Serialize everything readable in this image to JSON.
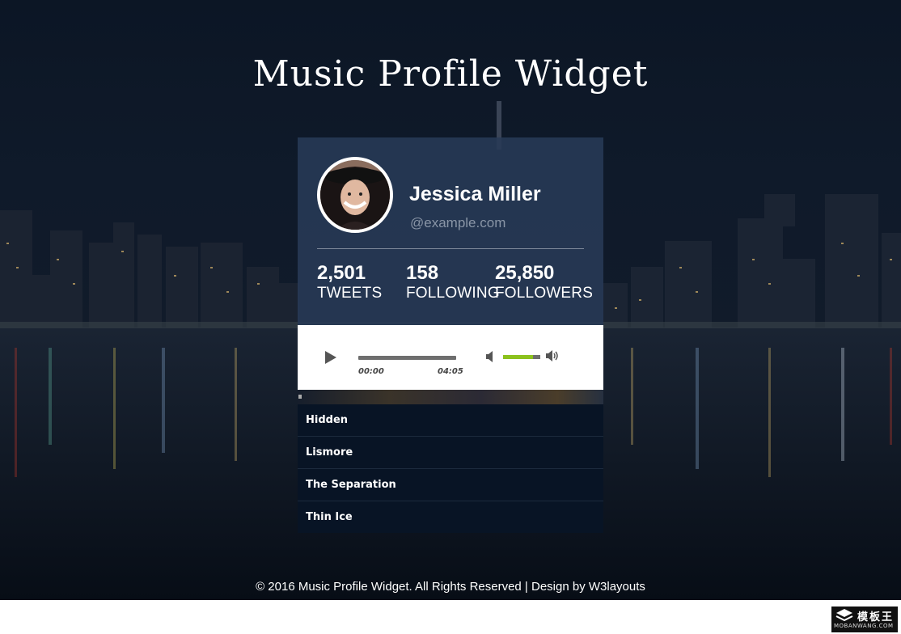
{
  "page": {
    "title": "Music Profile Widget"
  },
  "profile": {
    "name": "Jessica Miller",
    "handle": "@example.com",
    "stats": [
      {
        "value": "2,501",
        "label": "TWEETS"
      },
      {
        "value": "158",
        "label": "FOLLOWING"
      },
      {
        "value": "25,850",
        "label": "FOLLOWERS"
      }
    ]
  },
  "player": {
    "current_time": "00:00",
    "duration": "04:05",
    "progress": 0,
    "volume": 0.8,
    "colors": {
      "volume_fill": "#8cc21d"
    }
  },
  "playlist": {
    "tracks": [
      "Hidden",
      "Lismore",
      "The Separation",
      "Thin Ice"
    ]
  },
  "footer": {
    "text": "© 2016 Music Profile Widget. All Rights Reserved | Design by ",
    "link": "W3layouts"
  },
  "watermark": {
    "main": "模板王",
    "sub": "MOBANWANG.COM"
  }
}
